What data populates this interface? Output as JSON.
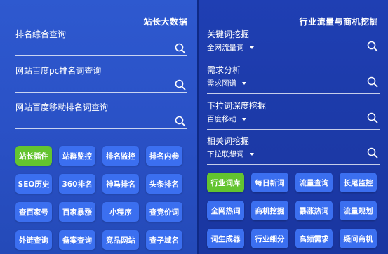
{
  "left": {
    "title": "站长大数据",
    "fields": [
      {
        "label": "排名综合查询"
      },
      {
        "label": "网站百度pc排名词查询"
      },
      {
        "label": "网站百度移动排名词查询"
      }
    ],
    "buttons": [
      {
        "label": "站长插件",
        "active": true
      },
      {
        "label": "站群监控"
      },
      {
        "label": "排名监控"
      },
      {
        "label": "排名内参"
      },
      {
        "label": "SEO历史"
      },
      {
        "label": "360排名"
      },
      {
        "label": "神马排名"
      },
      {
        "label": "头条排名"
      },
      {
        "label": "查百家号"
      },
      {
        "label": "百家暴涨"
      },
      {
        "label": "小程序"
      },
      {
        "label": "查竞价词"
      },
      {
        "label": "外链查询"
      },
      {
        "label": "备案查询"
      },
      {
        "label": "竞品网站"
      },
      {
        "label": "查子域名"
      }
    ]
  },
  "right": {
    "title": "行业流量与商机挖掘",
    "fields": [
      {
        "label": "关键词挖掘",
        "selected": "全网流量词"
      },
      {
        "label": "需求分析",
        "selected": "需求图谱"
      },
      {
        "label": "下拉词深度挖掘",
        "selected": "百度移动"
      },
      {
        "label": "相关词挖掘",
        "selected": "下拉联想词"
      }
    ],
    "buttons": [
      {
        "label": "行业词库",
        "active": true
      },
      {
        "label": "每日新词"
      },
      {
        "label": "流量查询"
      },
      {
        "label": "长尾监控"
      },
      {
        "label": "全网热词"
      },
      {
        "label": "商机挖掘"
      },
      {
        "label": "暴涨热词"
      },
      {
        "label": "流量规划"
      },
      {
        "label": "词生成器"
      },
      {
        "label": "行业细分"
      },
      {
        "label": "高频需求"
      },
      {
        "label": "疑问商机"
      }
    ]
  },
  "colors": {
    "button_blue": "#3b6ff0",
    "button_green": "#63c42f",
    "panel_left": "#2a51c6",
    "panel_right": "#1c3aa8"
  },
  "icons": {
    "field_action": "search-icon",
    "dropdown": "chevron-down-icon"
  }
}
